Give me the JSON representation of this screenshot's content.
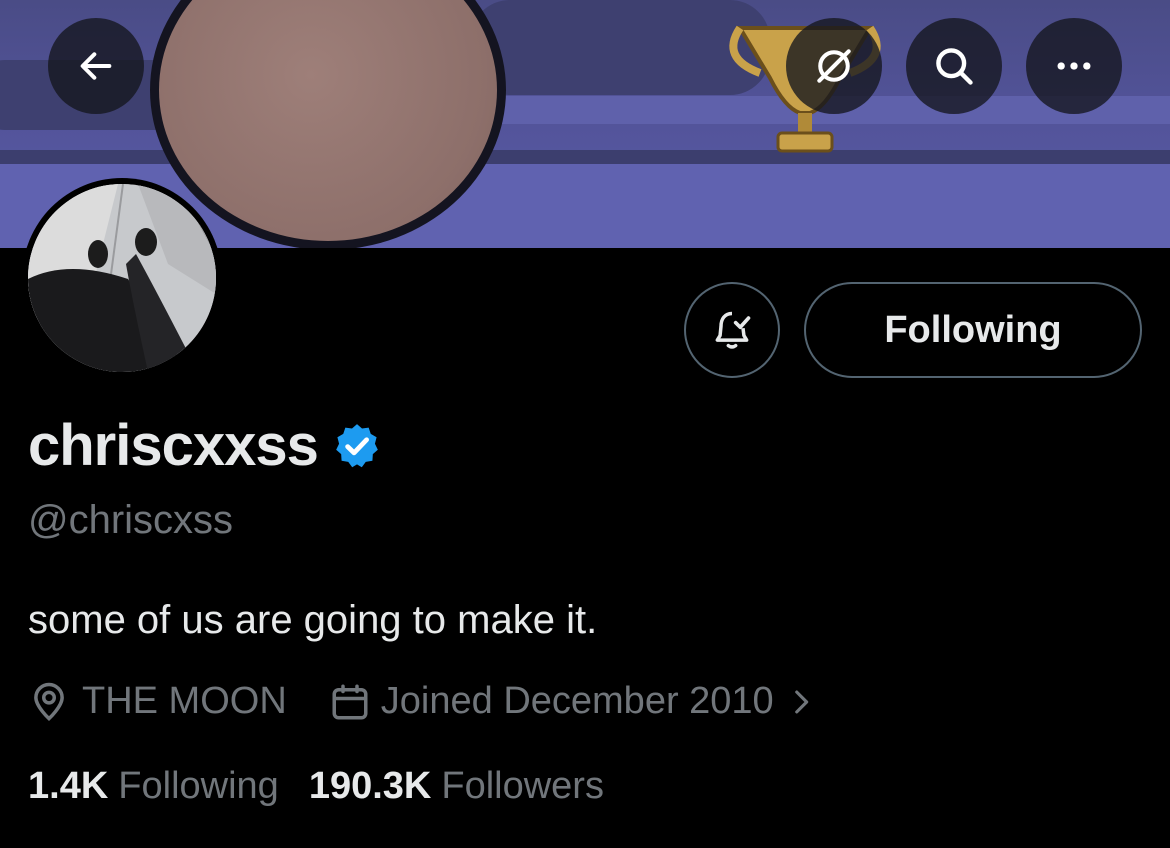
{
  "colors": {
    "background": "#000000",
    "primary_text": "#e7e9ea",
    "secondary_text": "#71767b",
    "border": "#536471",
    "verified_badge": "#1d9bf0"
  },
  "header": {
    "back_icon": "arrow-left-icon",
    "grok_icon": "grok-icon",
    "search_icon": "search-icon",
    "more_icon": "more-horizontal-icon"
  },
  "actions": {
    "notify_icon": "bell-check-icon",
    "following_label": "Following"
  },
  "profile": {
    "display_name": "chriscxxss",
    "verified": true,
    "handle": "@chriscxss",
    "bio": "some of us are going to make it.",
    "location": "THE MOON",
    "joined": "Joined December 2010",
    "following_count": "1.4K",
    "following_label": "Following",
    "followers_count": "190.3K",
    "followers_label": "Followers"
  }
}
